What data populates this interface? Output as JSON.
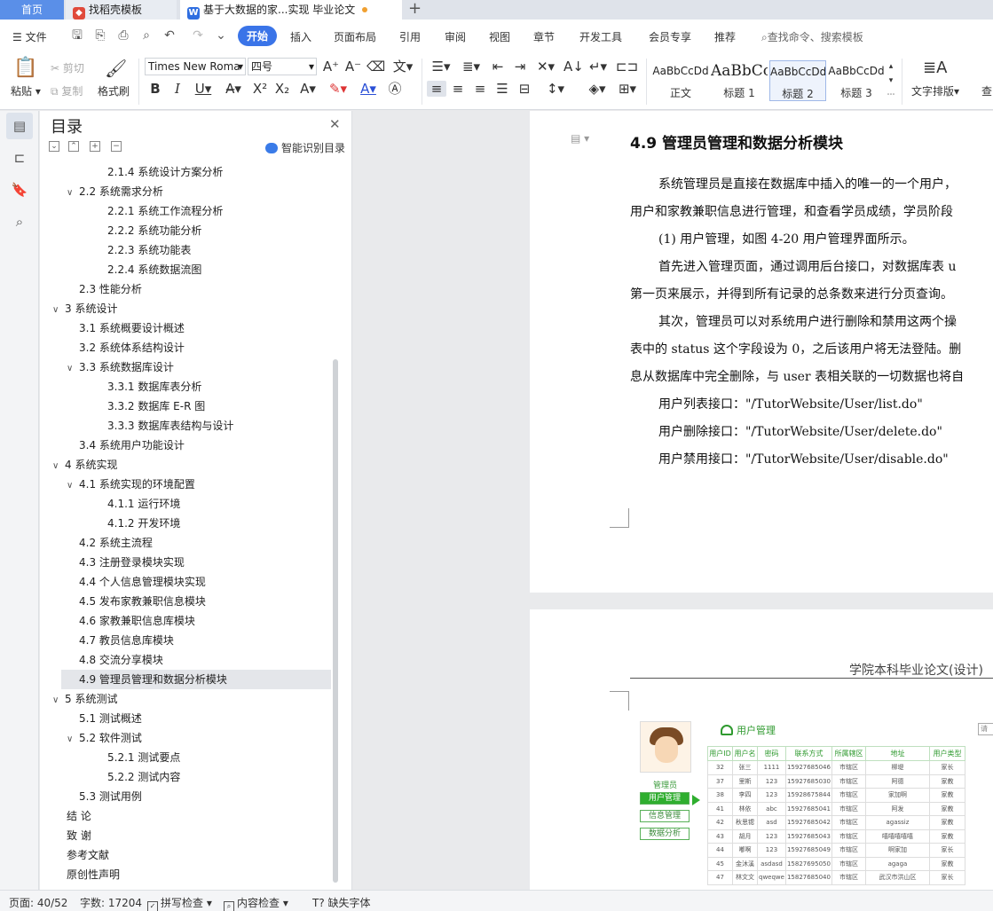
{
  "tabs": [
    {
      "label": "首页"
    },
    {
      "label": "找稻壳模板"
    },
    {
      "label": "基于大数据的家...实现 毕业论文"
    }
  ],
  "menu": [
    "文件",
    "开始",
    "插入",
    "页面布局",
    "引用",
    "审阅",
    "视图",
    "章节",
    "开发工具",
    "会员专享",
    "推荐"
  ],
  "search_placeholder": "查找命令、搜索模板",
  "ribbon": {
    "paste": "粘贴",
    "cut": "剪切",
    "copy": "复制",
    "format_painter": "格式刷",
    "font_name": "Times New Roma",
    "font_size": "四号",
    "styles": [
      {
        "sample": "AaBbCcDd",
        "name": "正文"
      },
      {
        "sample": "AaBbCc",
        "name": "标题 1"
      },
      {
        "sample": "AaBbCcDd",
        "name": "标题 2"
      },
      {
        "sample": "AaBbCcDd",
        "name": "标题 3"
      }
    ],
    "text_layout": "文字排版",
    "find": "查"
  },
  "toc": {
    "title": "目录",
    "smart_label": "智能识别目录",
    "items": [
      {
        "label": "2.1.4  系统设计方案分析",
        "level": 3
      },
      {
        "label": "2.2  系统需求分析",
        "level": 2,
        "expanded": true
      },
      {
        "label": "2.2.1  系统工作流程分析",
        "level": 3
      },
      {
        "label": "2.2.2  系统功能分析",
        "level": 3
      },
      {
        "label": "2.2.3  系统功能表",
        "level": 3
      },
      {
        "label": "2.2.4  系统数据流图",
        "level": 3
      },
      {
        "label": "2.3  性能分析",
        "level": 2
      },
      {
        "label": "3  系统设计",
        "level": 1,
        "expanded": true
      },
      {
        "label": "3.1  系统概要设计概述",
        "level": 2
      },
      {
        "label": "3.2  系统体系结构设计",
        "level": 2
      },
      {
        "label": "3.3  系统数据库设计",
        "level": 2,
        "expanded": true
      },
      {
        "label": "3.3.1  数据库表分析",
        "level": 3
      },
      {
        "label": "3.3.2  数据库 E-R 图",
        "level": 3
      },
      {
        "label": "3.3.3  数据库表结构与设计",
        "level": 3
      },
      {
        "label": "3.4  系统用户功能设计",
        "level": 2
      },
      {
        "label": "4  系统实现",
        "level": 1,
        "expanded": true
      },
      {
        "label": "4.1  系统实现的环境配置",
        "level": 2,
        "expanded": true
      },
      {
        "label": "4.1.1  运行环境",
        "level": 3
      },
      {
        "label": "4.1.2  开发环境",
        "level": 3
      },
      {
        "label": "4.2  系统主流程",
        "level": 2
      },
      {
        "label": "4.3  注册登录模块实现",
        "level": 2
      },
      {
        "label": "4.4  个人信息管理模块实现",
        "level": 2
      },
      {
        "label": "4.5  发布家教兼职信息模块",
        "level": 2
      },
      {
        "label": "4.6  家教兼职信息库模块",
        "level": 2
      },
      {
        "label": "4.7  教员信息库模块",
        "level": 2
      },
      {
        "label": "4.8  交流分享模块",
        "level": 2
      },
      {
        "label": "4.9  管理员管理和数据分析模块",
        "level": 2,
        "selected": true
      },
      {
        "label": "5  系统测试",
        "level": 1,
        "expanded": true
      },
      {
        "label": "5.1  测试概述",
        "level": 2
      },
      {
        "label": "5.2  软件测试",
        "level": 2,
        "expanded": true
      },
      {
        "label": "5.2.1  测试要点",
        "level": 3
      },
      {
        "label": "5.2.2  测试内容",
        "level": 3
      },
      {
        "label": "5.3  测试用例",
        "level": 2
      },
      {
        "label": "结    论",
        "level": 0
      },
      {
        "label": "致    谢",
        "level": 0
      },
      {
        "label": "参考文献",
        "level": 0
      },
      {
        "label": "原创性声明",
        "level": 0
      }
    ]
  },
  "document": {
    "heading": "4.9  管理员管理和数据分析模块",
    "lines": [
      "系统管理员是直接在数据库中插入的唯一的一个用户，",
      "用户和家教兼职信息进行管理，和查看学员成绩，学员阶段",
      "(1)  用户管理，如图 4-20 用户管理界面所示。",
      "首先进入管理页面，通过调用后台接口，对数据库表 u",
      "第一页来展示，并得到所有记录的总条数来进行分页查询。",
      "其次，管理员可以对系统用户进行删除和禁用这两个操",
      "表中的 status 这个字段设为 0，之后该用户将无法登陆。删",
      "息从数据库中完全删除，与 user 表相关联的一切数据也将自",
      "用户列表接口：\"/TutorWebsite/User/list.do\"",
      "用户删除接口：\"/TutorWebsite/User/delete.do\"",
      "用户禁用接口：\"/TutorWebsite/User/disable.do\""
    ],
    "page2_header": "学院本科毕业论文(设计)"
  },
  "figure": {
    "title": "用户管理",
    "admin_label": "管理员",
    "search_hint": "请",
    "nav": [
      "用户管理",
      "信息管理",
      "数据分析"
    ],
    "columns": [
      "用户ID",
      "用户名",
      "密码",
      "联系方式",
      "所属辖区",
      "地址",
      "用户类型"
    ],
    "rows": [
      [
        "32",
        "张三",
        "1111",
        "15927685046",
        "市辖区",
        "柳堤",
        "家长"
      ],
      [
        "37",
        "里斯",
        "123",
        "15927685030",
        "市辖区",
        "阿德",
        "家教"
      ],
      [
        "38",
        "李四",
        "123",
        "15928675844",
        "市辖区",
        "家加啊",
        "家教"
      ],
      [
        "41",
        "林依",
        "abc",
        "15927685041",
        "市辖区",
        "阿发",
        "家教"
      ],
      [
        "42",
        "秋思锶",
        "asd",
        "15927685042",
        "市辖区",
        "agassiz",
        "家教"
      ],
      [
        "43",
        "胡月",
        "123",
        "15927685043",
        "市辖区",
        "嘻嘻嘻嘻嘻",
        "家教"
      ],
      [
        "44",
        "嘟啊",
        "123",
        "15927685049",
        "市辖区",
        "啊家加",
        "家长"
      ],
      [
        "45",
        "金沐溪",
        "asdasd",
        "15827695050",
        "市辖区",
        "agaga",
        "家教"
      ],
      [
        "47",
        "林文文",
        "qweqwe",
        "15827685040",
        "市辖区",
        "武汉市洪山区",
        "家长"
      ]
    ]
  },
  "status": {
    "page": "页面: 40/52",
    "words": "字数: 17204",
    "spell": "拼写检查",
    "content_check": "内容检查",
    "missing_font": "缺失字体"
  },
  "colors": {
    "accent": "#3a74e8",
    "figure_green": "#2fae2f"
  }
}
